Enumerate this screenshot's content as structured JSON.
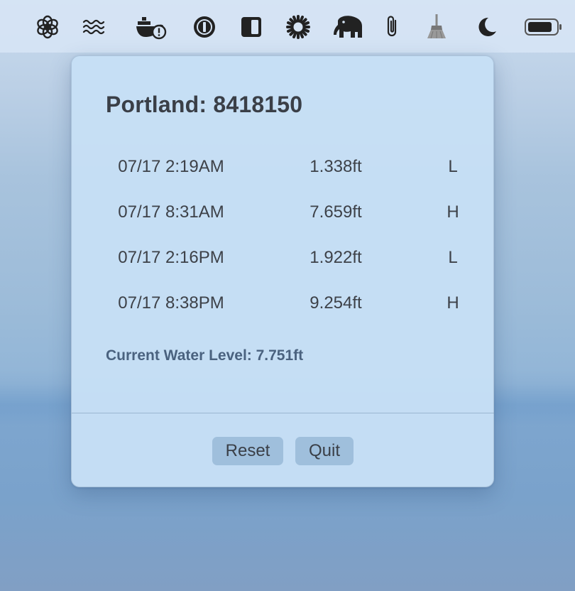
{
  "menubar": {
    "icons": [
      "openai-icon",
      "waves-icon",
      "docker-icon",
      "1password-icon",
      "sidebar-icon",
      "sun-icon",
      "elephant-icon",
      "paperclip-icon",
      "broom-icon",
      "moon-icon",
      "battery-icon"
    ]
  },
  "popover": {
    "title": "Portland: 8418150",
    "tides": [
      {
        "time": "07/17 2:19AM",
        "height": "1.338ft",
        "type": "L"
      },
      {
        "time": "07/17 8:31AM",
        "height": "7.659ft",
        "type": "H"
      },
      {
        "time": "07/17 2:16PM",
        "height": "1.922ft",
        "type": "L"
      },
      {
        "time": "07/17 8:38PM",
        "height": "9.254ft",
        "type": "H"
      }
    ],
    "current_level": "Current Water Level: 7.751ft",
    "reset_label": "Reset",
    "quit_label": "Quit"
  },
  "colors": {
    "popover_bg": "#c6dff5",
    "text": "#3a3f47",
    "current_level_text": "#4a627f",
    "button_bg": "#a3bed8"
  }
}
